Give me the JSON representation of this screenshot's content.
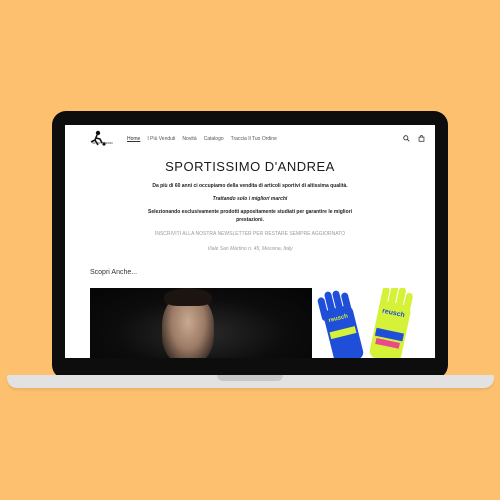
{
  "site": {
    "logo_text": "SPORTISSIMO",
    "nav": [
      "Home",
      "I Più Venduti",
      "Novità",
      "Catalogo",
      "Traccia Il Tuo Ordine"
    ],
    "icons": [
      "search-icon",
      "bag-icon"
    ]
  },
  "main": {
    "title": "SPORTISSIMO D'ANDREA",
    "line1": "Da più di 60 anni ci occupiamo della vendita di articoli sportivi di altissima qualità.",
    "line2": "Trattando solo i migliori marchi",
    "line3a": "Selezionando esclusivamente prodotti appositamente studiati per garantire le migliori",
    "line3b": "prestazioni.",
    "newsletter": "INSCRIVITI ALLA NOSTRA NEWSLETTER PER RESTARE SEMPRE AGGIORNATO",
    "address": "Viale San Martino n. 45, Messina, Italy",
    "discover": "Scopri Anche..."
  },
  "products": {
    "gloves_brand": "reusch"
  },
  "colors": {
    "background": "#fdc06f",
    "laptop": "#0d0d0d",
    "glove_blue": "#1f4fd8",
    "glove_yellow": "#d6f238"
  }
}
